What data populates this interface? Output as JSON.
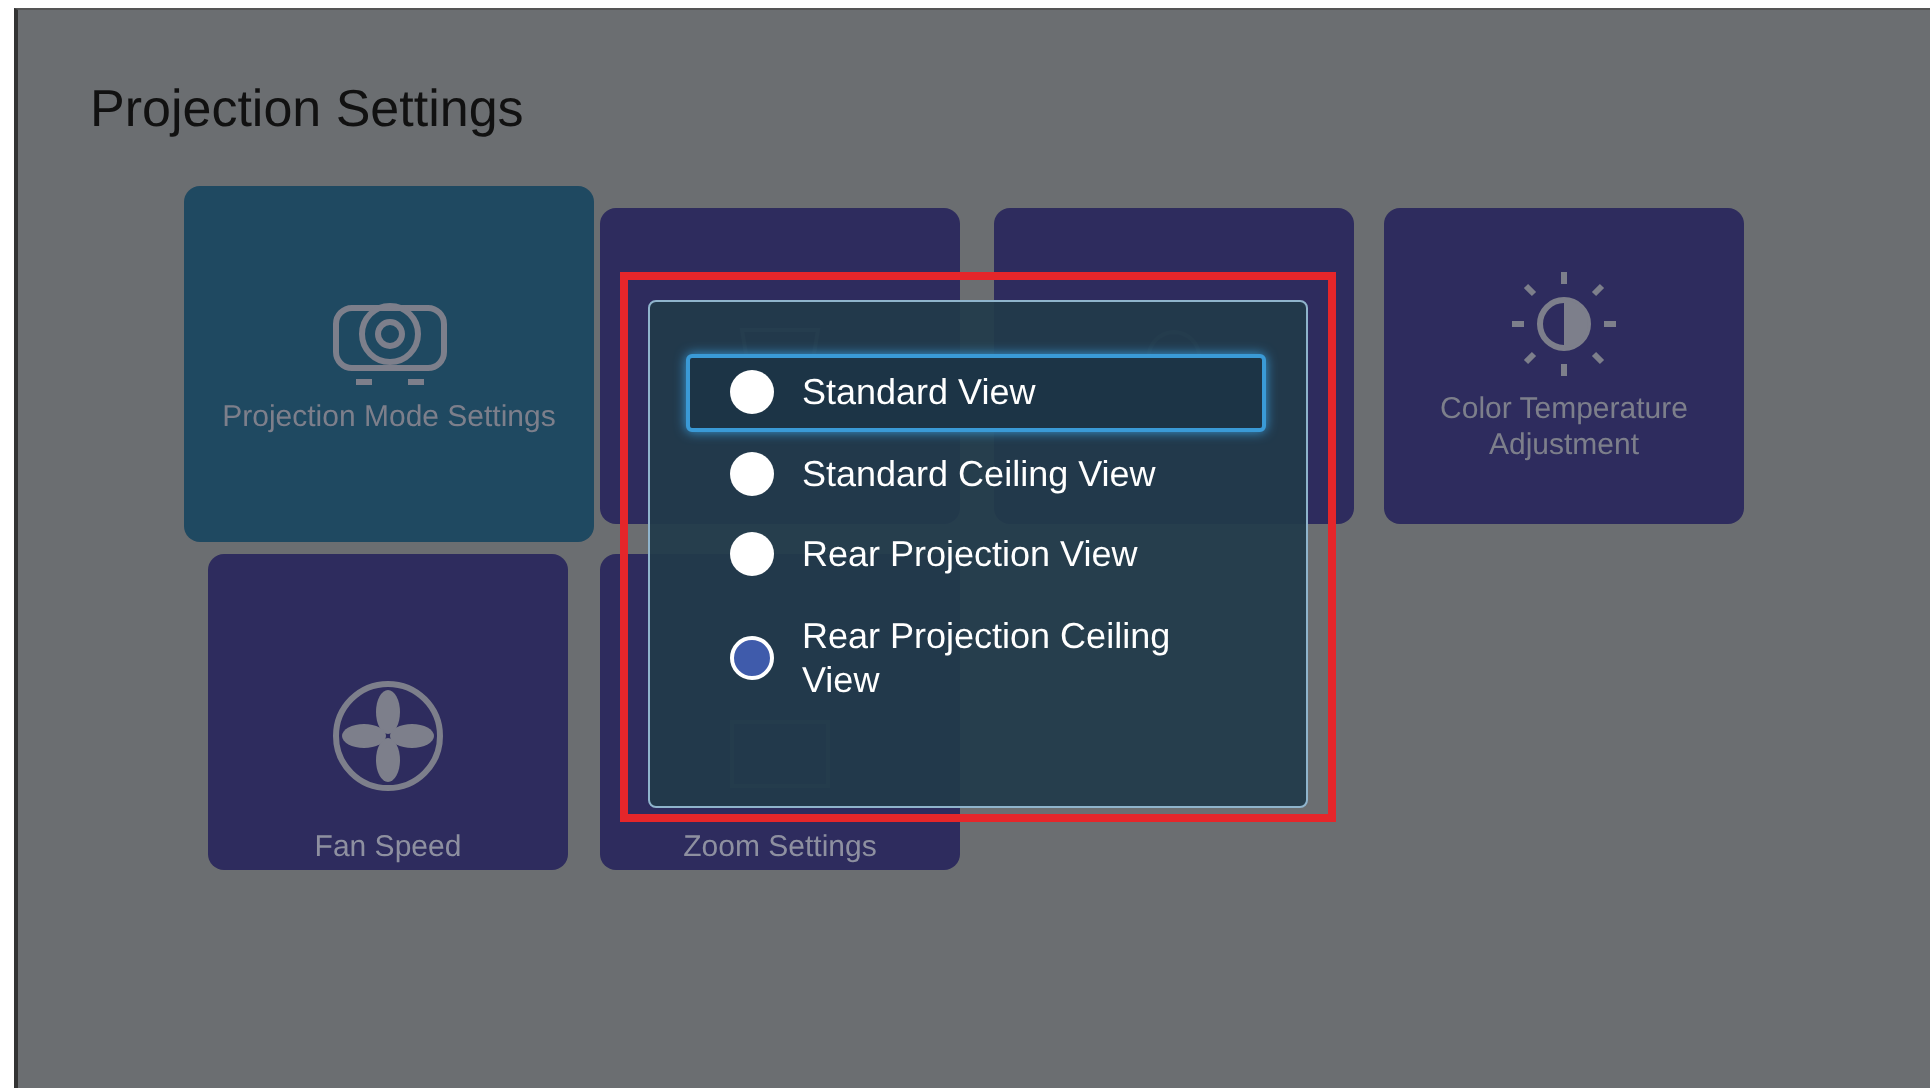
{
  "title": "Projection Settings",
  "tiles": [
    {
      "kind": "projector",
      "label": "Projection Mode Settings",
      "focused": true
    },
    {
      "kind": "keystone",
      "focused": false
    },
    {
      "kind": "bulb",
      "focused": false
    },
    {
      "kind": "contrast",
      "label": "Color Temperature Adjustment",
      "focused": false
    },
    {
      "kind": "fan",
      "label": "Fan Speed",
      "focused": false
    },
    {
      "kind": "zoom",
      "label": "Zoom Settings",
      "focused": false
    }
  ],
  "dialog": {
    "options": [
      {
        "label": "Standard View",
        "focused": true,
        "selected": false
      },
      {
        "label": "Standard Ceiling View",
        "focused": false,
        "selected": false
      },
      {
        "label": "Rear Projection View",
        "focused": false,
        "selected": false
      },
      {
        "label": "Rear Projection Ceiling View",
        "focused": false,
        "selected": true
      }
    ]
  }
}
